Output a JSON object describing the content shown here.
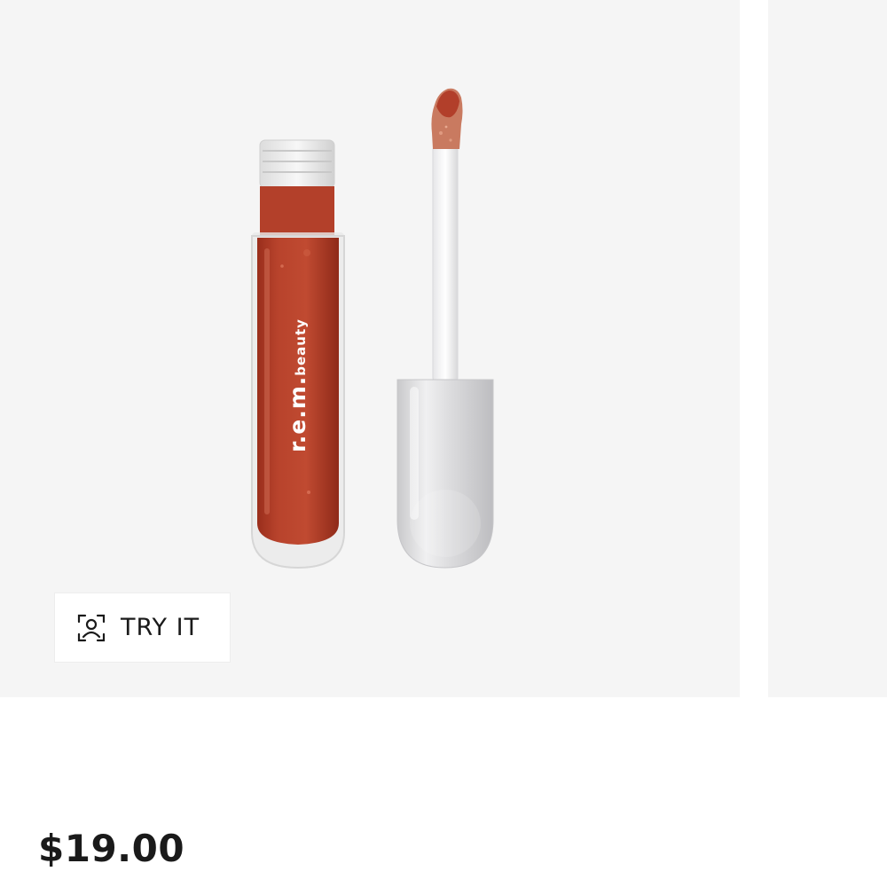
{
  "product": {
    "brand_on_tube": "r.e.m.beauty",
    "price": "$19.00",
    "colors": {
      "background": "#f5f5f5",
      "lip_shade": "#b6412a",
      "cap": "#dedede"
    }
  },
  "actions": {
    "try_it_label": "TRY IT",
    "try_it_icon": "face-scan-icon"
  }
}
